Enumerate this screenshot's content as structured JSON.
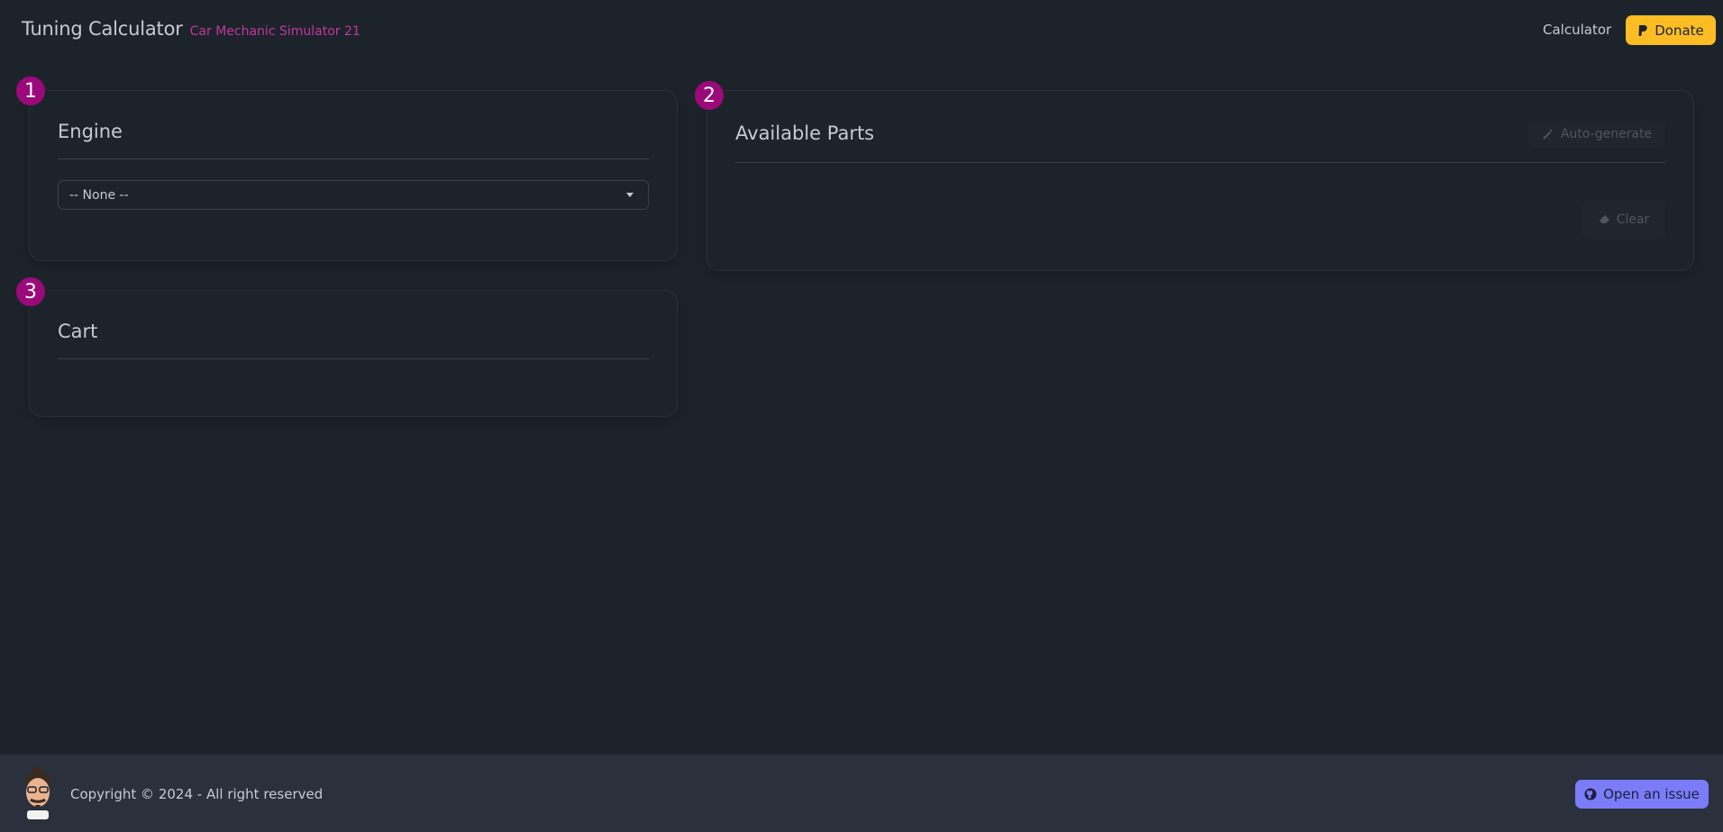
{
  "header": {
    "title": "Tuning Calculator",
    "subtitle": "Car Mechanic Simulator 21",
    "nav_calculator": "Calculator",
    "donate_label": "Donate"
  },
  "engine": {
    "step": "1",
    "title": "Engine",
    "selected": "-- None --"
  },
  "parts": {
    "step": "2",
    "title": "Available Parts",
    "auto_generate_label": "Auto-generate",
    "clear_label": "Clear"
  },
  "cart": {
    "step": "3",
    "title": "Cart"
  },
  "footer": {
    "copyright": "Copyright © 2024 - All right reserved",
    "issue_label": "Open an issue"
  },
  "colors": {
    "background": "#1d232a",
    "accent": "#9b0a7a",
    "donate": "#fbbd23",
    "issue": "#7b7cf8",
    "footer": "#2a303c"
  },
  "icons": {
    "donate": "paypal-icon",
    "auto_generate": "magic-wand-icon",
    "clear": "eraser-icon",
    "issue": "github-icon",
    "select": "caret-down-icon"
  }
}
